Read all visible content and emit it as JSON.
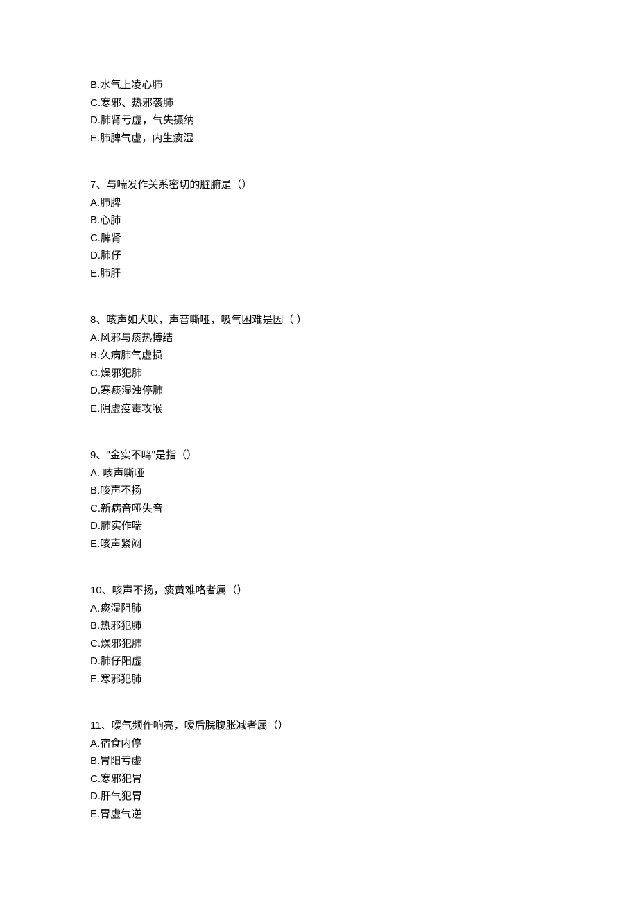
{
  "blocks": [
    {
      "stem": "",
      "options": [
        {
          "letter": "B.",
          "text": "水气上凌心肺"
        },
        {
          "letter": "C.",
          "text": "寒邪、热邪袭肺"
        },
        {
          "letter": "D.",
          "text": "肺肾亏虚，气失摄纳"
        },
        {
          "letter": "E.",
          "text": "肺脾气虚，内生痰湿"
        }
      ]
    },
    {
      "stem": "7、与喘发作关系密切的脏腑是（）",
      "options": [
        {
          "letter": "A.",
          "text": "肺脾"
        },
        {
          "letter": "B.",
          "text": "心肺"
        },
        {
          "letter": "C.",
          "text": "脾肾"
        },
        {
          "letter": "D.",
          "text": "肺仔"
        },
        {
          "letter": "E.",
          "text": "肺肝"
        }
      ]
    },
    {
      "stem": "8、咳声如犬吠，声音嘶哑，吸气困难是因（ ）",
      "options": [
        {
          "letter": "A.",
          "text": "风邪与痰热搏结"
        },
        {
          "letter": "B.",
          "text": "久病肺气虚损"
        },
        {
          "letter": "C.",
          "text": "燥邪犯肺"
        },
        {
          "letter": "D.",
          "text": "寒痰湿浊停肺"
        },
        {
          "letter": "E.",
          "text": "阴虚疫毒攻喉"
        }
      ]
    },
    {
      "stem": "9、\"金实不鸣\"是指（）",
      "options": [
        {
          "letter": "A. ",
          "text": "咳声嘶哑"
        },
        {
          "letter": "B.",
          "text": "咳声不扬"
        },
        {
          "letter": "C.",
          "text": "新病音哑失音"
        },
        {
          "letter": "D.",
          "text": "肺实作喘"
        },
        {
          "letter": "E.",
          "text": "咳声紧闷"
        }
      ]
    },
    {
      "stem": "10、咳声不扬，痰黄难咯者属（）",
      "options": [
        {
          "letter": "A.",
          "text": "痰湿阻肺"
        },
        {
          "letter": "B.",
          "text": "热邪犯肺"
        },
        {
          "letter": "C.",
          "text": "燥邪犯肺"
        },
        {
          "letter": "D.",
          "text": "肺仔阳虚"
        },
        {
          "letter": "E.",
          "text": "寒邪犯肺"
        }
      ]
    },
    {
      "stem": "11、嗳气频作响亮，嗳后脘腹胀减者属（）",
      "options": [
        {
          "letter": "A.",
          "text": "宿食内停"
        },
        {
          "letter": "B.",
          "text": "胃阳亏虚"
        },
        {
          "letter": "C.",
          "text": "寒邪犯胃"
        },
        {
          "letter": "D.",
          "text": "肝气犯胃"
        },
        {
          "letter": "E.",
          "text": "胃虚气逆"
        }
      ]
    }
  ]
}
